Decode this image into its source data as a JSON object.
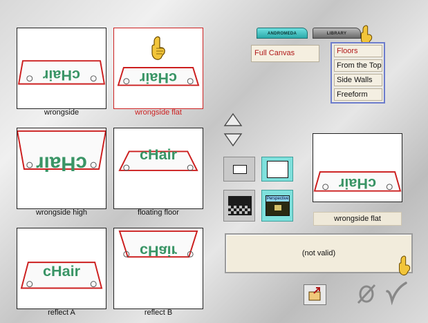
{
  "thumbnails": [
    {
      "label": "wrongside",
      "selected": false
    },
    {
      "label": "wrongside flat",
      "selected": true
    },
    {
      "label": "wrongside high",
      "selected": false
    },
    {
      "label": "floating floor",
      "selected": false
    },
    {
      "label": "reflect A",
      "selected": false
    },
    {
      "label": "reflect B",
      "selected": false
    }
  ],
  "tabs": {
    "andromeda": "ANDROMEDA",
    "library": "LIBRARY"
  },
  "canvas_mode": "Full Canvas",
  "options": [
    "Floors",
    "From the Top",
    "Side Walls",
    "Freeform"
  ],
  "active_option": "Floors",
  "perspective_thumb_label": "Perspective",
  "preview_label": "wrongside flat",
  "status_text": "(not valid)",
  "chair_text": "cHair",
  "icons": {
    "pointer": "pointing-hand-icon",
    "up": "arrow-up-icon",
    "down": "arrow-down-icon",
    "export": "export-icon",
    "cancel": "null-icon",
    "confirm": "checkmark-icon"
  },
  "colors": {
    "accent_red": "#cc1f1f",
    "teal": "#7fe0dc",
    "chair_green": "#3a9566"
  }
}
